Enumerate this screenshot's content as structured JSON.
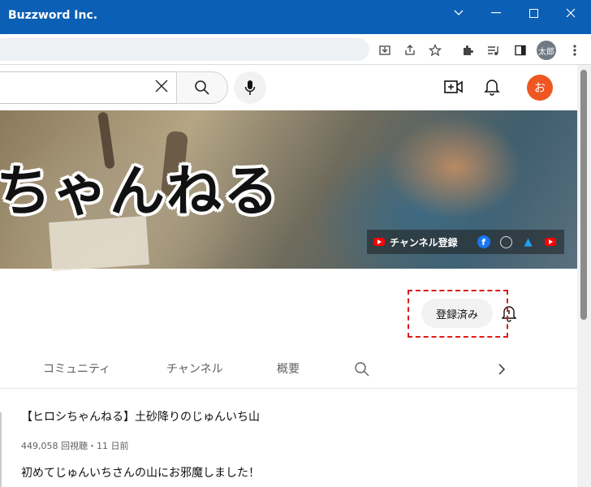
{
  "window": {
    "title": "Buzzword Inc.",
    "buttons": [
      "chevron",
      "minimize",
      "maximize",
      "close"
    ]
  },
  "browser": {
    "profile_avatar": "太郎",
    "toolbar_icons": [
      "install-icon",
      "share-icon",
      "star-icon",
      "extensions-icon",
      "media-icon",
      "side-panel-icon",
      "menu-icon"
    ]
  },
  "youtube_header": {
    "search_value": "",
    "user_avatar": "お"
  },
  "banner": {
    "logo_text": "ちゃんねる",
    "subscribe_link": "チャンネル登録",
    "social_icons": [
      "facebook-icon",
      "globe-icon",
      "twitter-icon",
      "youtube-icon"
    ]
  },
  "channel": {
    "subscribed_label": "登録済み"
  },
  "tabs": [
    "コミュニティ",
    "チャンネル",
    "概要"
  ],
  "post": {
    "title": "【ヒロシちゃんねる】土砂降りのじゅんいち山",
    "meta": "449,058 回視聴・11 日前",
    "description": "初めてじゅんいちさんの山にお邪魔しました！"
  },
  "colors": {
    "titlebar": "#0b5fb5",
    "avatar": "#ef5722",
    "highlight": "#e01a1a"
  }
}
